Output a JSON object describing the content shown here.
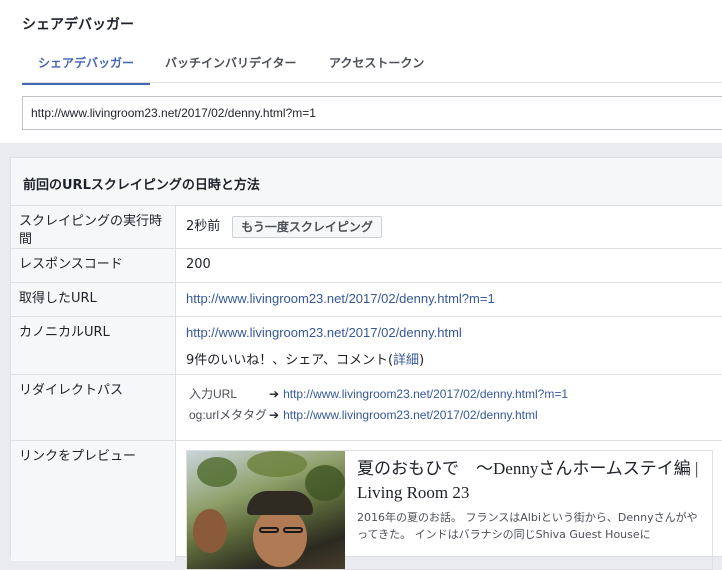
{
  "app": {
    "title": "シェアデバッガー"
  },
  "tabs": [
    {
      "label": "シェアデバッガー",
      "active": true
    },
    {
      "label": "バッチインバリデイター",
      "active": false
    },
    {
      "label": "アクセストークン",
      "active": false
    }
  ],
  "url_input": {
    "value": "http://www.livingroom23.net/2017/02/denny.html?m=1"
  },
  "panel": {
    "title": "前回のURLスクレイピングの日時と方法",
    "scrape": {
      "label": "スクレイピングの実行時間",
      "value": "2秒前",
      "button": "もう一度スクレイピング"
    },
    "response": {
      "label": "レスポンスコード",
      "value": "200"
    },
    "fetched": {
      "label": "取得したURL",
      "url": "http://www.livingroom23.net/2017/02/denny.html?m=1"
    },
    "canonical": {
      "label": "カノニカルURL",
      "url": "http://www.livingroom23.net/2017/02/denny.html",
      "likes_prefix": "9件のいいね！、シェア、コメント(",
      "likes_link": "詳細",
      "likes_suffix": ")"
    },
    "redirect": {
      "label": "リダイレクトパス",
      "rows": [
        {
          "key": "入力URL",
          "arrow": "➔",
          "url": "http://www.livingroom23.net/2017/02/denny.html?m=1"
        },
        {
          "key": "og:urlメタタグ",
          "arrow": "➔",
          "url": "http://www.livingroom23.net/2017/02/denny.html"
        }
      ]
    },
    "preview": {
      "label": "リンクをプレビュー",
      "title": "夏のおもひで　〜Dennyさんホームステイ編 | Living Room 23",
      "description": "2016年の夏のお話。 フランスはAlbiという街から、Dennyさんがやってきた。 インドはバラナシの同じShiva Guest Houseに"
    }
  }
}
